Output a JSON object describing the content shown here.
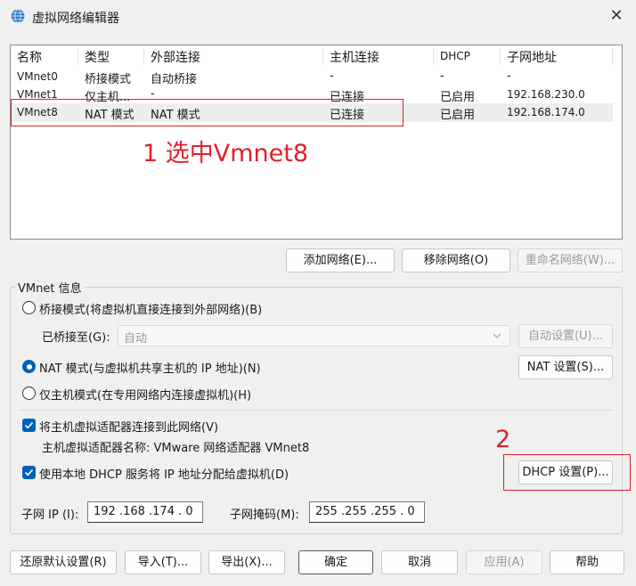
{
  "window": {
    "title": "虚拟网络编辑器"
  },
  "list": {
    "headers": [
      "名称",
      "类型",
      "外部连接",
      "主机连接",
      "DHCP",
      "子网地址"
    ],
    "rows": [
      [
        "VMnet0",
        "桥接模式",
        "自动桥接",
        "-",
        "-",
        "-"
      ],
      [
        "VMnet1",
        "仅主机...",
        "-",
        "已连接",
        "已启用",
        "192.168.230.0"
      ],
      [
        "VMnet8",
        "NAT 模式",
        "NAT 模式",
        "已连接",
        "已启用",
        "192.168.174.0"
      ]
    ],
    "selected_row": 2
  },
  "list_buttons": {
    "add": "添加网络(E)...",
    "remove": "移除网络(O)",
    "rename": "重命名网络(W)..."
  },
  "info": {
    "group_title": "VMnet 信息",
    "radio_bridge": "桥接模式(将虚拟机直接连接到外部网络)(B)",
    "bridged_to_label": "已桥接至(G):",
    "bridged_to_value": "自动",
    "auto_settings": "自动设置(U)...",
    "radio_nat": "NAT 模式(与虚拟机共享主机的 IP 地址)(N)",
    "nat_settings": "NAT 设置(S)...",
    "radio_hostonly": "仅主机模式(在专用网络内连接虚拟机)(H)",
    "selected_mode": "nat",
    "check_connect": "将主机虚拟适配器连接到此网络(V)",
    "adapter_name": "主机虚拟适配器名称: VMware 网络适配器 VMnet8",
    "check_dhcp": "使用本地 DHCP 服务将 IP 地址分配给虚拟机(D)",
    "dhcp_settings": "DHCP 设置(P)...",
    "subnet_ip_label": "子网 IP (I):",
    "subnet_ip_value": "192 .168 .174 . 0",
    "subnet_mask_label": "子网掩码(M):",
    "subnet_mask_value": "255 .255 .255 . 0"
  },
  "bottom_buttons": {
    "restore": "还原默认设置(R)",
    "import": "导入(T)...",
    "export": "导出(X)...",
    "ok": "确定",
    "cancel": "取消",
    "apply": "应用(A)",
    "help": "帮助"
  },
  "annotations": {
    "step1": "1 选中Vmnet8",
    "step2": "2"
  },
  "colors": {
    "accent": "#005fb8",
    "annotation": "#e0202a"
  }
}
